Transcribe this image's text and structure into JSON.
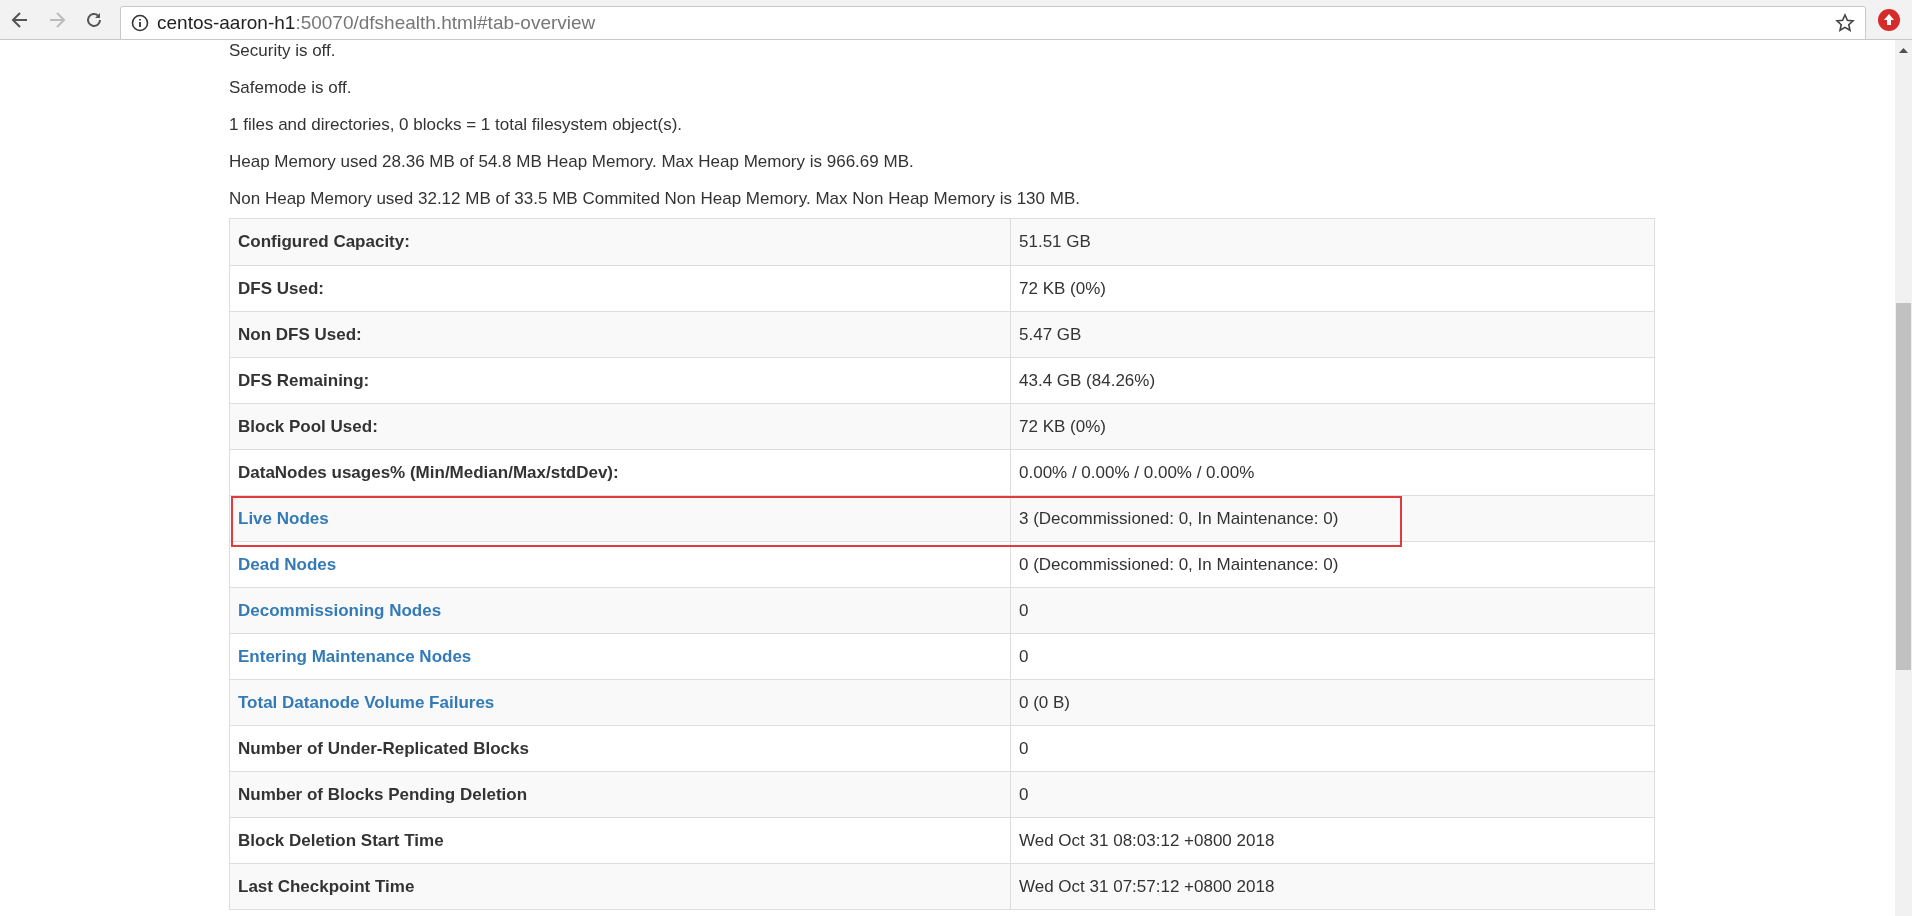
{
  "browser": {
    "url_host": "centos-aaron-h1",
    "url_rest": ":50070/dfshealth.html#tab-overview"
  },
  "summary": [
    "Security is off.",
    "Safemode is off.",
    "1 files and directories, 0 blocks = 1 total filesystem object(s).",
    "Heap Memory used 28.36 MB of 54.8 MB Heap Memory. Max Heap Memory is 966.69 MB.",
    "Non Heap Memory used 32.12 MB of 33.5 MB Commited Non Heap Memory. Max Non Heap Memory is 130 MB."
  ],
  "table": {
    "rows": [
      {
        "label": "Configured Capacity:",
        "value": "51.51 GB",
        "link": false,
        "highlighted": false
      },
      {
        "label": "DFS Used:",
        "value": "72 KB (0%)",
        "link": false,
        "highlighted": false
      },
      {
        "label": "Non DFS Used:",
        "value": "5.47 GB",
        "link": false,
        "highlighted": false
      },
      {
        "label": "DFS Remaining:",
        "value": "43.4 GB (84.26%)",
        "link": false,
        "highlighted": false
      },
      {
        "label": "Block Pool Used:",
        "value": "72 KB (0%)",
        "link": false,
        "highlighted": false
      },
      {
        "label": "DataNodes usages% (Min/Median/Max/stdDev):",
        "value": "0.00% / 0.00% / 0.00% / 0.00%",
        "link": false,
        "highlighted": false
      },
      {
        "label": "Live Nodes",
        "value": "3 (Decommissioned: 0, In Maintenance: 0)",
        "link": true,
        "highlighted": true
      },
      {
        "label": "Dead Nodes",
        "value": "0 (Decommissioned: 0, In Maintenance: 0)",
        "link": true,
        "highlighted": false
      },
      {
        "label": "Decommissioning Nodes",
        "value": "0",
        "link": true,
        "highlighted": false
      },
      {
        "label": "Entering Maintenance Nodes",
        "value": "0",
        "link": true,
        "highlighted": false
      },
      {
        "label": "Total Datanode Volume Failures",
        "value": "0 (0 B)",
        "link": true,
        "highlighted": false
      },
      {
        "label": "Number of Under-Replicated Blocks",
        "value": "0",
        "link": false,
        "highlighted": false
      },
      {
        "label": "Number of Blocks Pending Deletion",
        "value": "0",
        "link": false,
        "highlighted": false
      },
      {
        "label": "Block Deletion Start Time",
        "value": "Wed Oct 31 08:03:12 +0800 2018",
        "link": false,
        "highlighted": false
      },
      {
        "label": "Last Checkpoint Time",
        "value": "Wed Oct 31 07:57:12 +0800 2018",
        "link": false,
        "highlighted": false
      }
    ]
  }
}
